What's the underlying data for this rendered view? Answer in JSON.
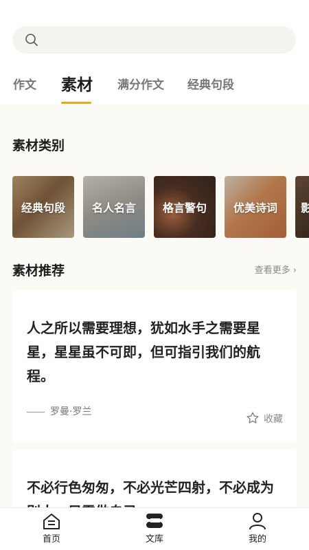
{
  "search": {
    "placeholder": ""
  },
  "tabs": [
    {
      "label": "作文",
      "active": false
    },
    {
      "label": "素材",
      "active": true
    },
    {
      "label": "满分作文",
      "active": false
    },
    {
      "label": "经典句段",
      "active": false
    }
  ],
  "categories_section": {
    "title": "素材类别",
    "items": [
      {
        "label": "经典句段"
      },
      {
        "label": "名人名言"
      },
      {
        "label": "格言警句"
      },
      {
        "label": "优美诗词"
      },
      {
        "label": "影"
      }
    ]
  },
  "recommend_section": {
    "title": "素材推荐",
    "more_label": "查看更多 ›",
    "cards": [
      {
        "text": "人之所以需要理想，犹如水手之需要星星，星星虽不可即，但可指引我们的航程。",
        "author": "罗曼·罗兰",
        "fav_label": "收藏"
      },
      {
        "text": "不必行色匆匆，不必光芒四射，不必成为别人，只需做自己。"
      }
    ]
  },
  "bottom_nav": [
    {
      "label": "首页",
      "icon": "home-icon"
    },
    {
      "label": "文库",
      "icon": "library-icon"
    },
    {
      "label": "我的",
      "icon": "user-icon"
    }
  ],
  "colors": {
    "accent": "#d6ad3b",
    "page_bg": "#fbfaf5",
    "card_bg": "#ffffff"
  }
}
